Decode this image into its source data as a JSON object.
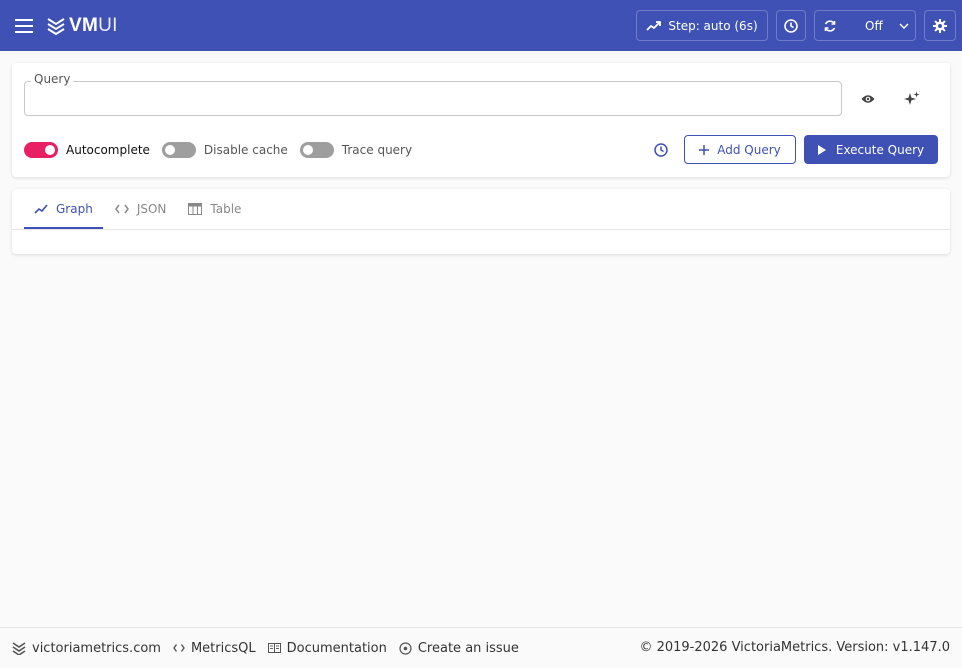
{
  "header": {
    "logo_vm": "VM",
    "logo_ui": "UI",
    "step_label": "Step: auto (6s)",
    "refresh_label": "Off"
  },
  "query": {
    "label": "Query",
    "value": "",
    "placeholder": ""
  },
  "toggles": {
    "autocomplete": "Autocomplete",
    "disable_cache": "Disable cache",
    "trace_query": "Trace query"
  },
  "actions": {
    "add_query": "Add Query",
    "execute_query": "Execute Query"
  },
  "tabs": [
    {
      "label": "Graph",
      "active": true
    },
    {
      "label": "JSON",
      "active": false
    },
    {
      "label": "Table",
      "active": false
    }
  ],
  "footer": {
    "site": "victoriametrics.com",
    "metricsql": "MetricsQL",
    "docs": "Documentation",
    "issue": "Create an issue",
    "copyright": "© 2019-2026 VictoriaMetrics. Version: v1.147.0"
  },
  "colors": {
    "primary": "#3f51b5",
    "toggle_on": "#e91e63",
    "toggle_off": "#9e9e9e"
  }
}
